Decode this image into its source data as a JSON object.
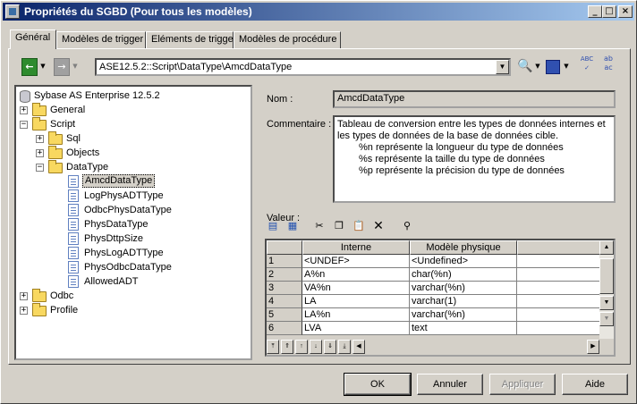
{
  "window": {
    "title": "Propriétés du SGBD (Pour tous les modèles)"
  },
  "tabs": [
    {
      "label": "Général"
    },
    {
      "label": "Modèles de trigger"
    },
    {
      "label": "Eléments de trigger"
    },
    {
      "label": "Modèles de procédure"
    }
  ],
  "toolbar": {
    "path": "ASE12.5.2::Script\\DataType\\AmcdDataType",
    "spell1": "ABC",
    "spell2": "ab"
  },
  "tree": [
    {
      "label": "Sybase AS Enterprise 12.5.2"
    },
    {
      "label": "General"
    },
    {
      "label": "Script"
    },
    {
      "label": "Sql"
    },
    {
      "label": "Objects"
    },
    {
      "label": "DataType"
    },
    {
      "label": "AmcdDataType"
    },
    {
      "label": "LogPhysADTType"
    },
    {
      "label": "OdbcPhysDataType"
    },
    {
      "label": "PhysDataType"
    },
    {
      "label": "PhysDttpSize"
    },
    {
      "label": "PhysLogADTType"
    },
    {
      "label": "PhysOdbcDataType"
    },
    {
      "label": "AllowedADT"
    },
    {
      "label": "Odbc"
    },
    {
      "label": "Profile"
    }
  ],
  "details": {
    "name_label": "Nom :",
    "name_value": "AmcdDataType",
    "comment_label": "Commentaire :",
    "comment_lines": [
      "Tableau de conversion entre les types de données internes et les types de données de la base de données cible.",
      "%n représente la longueur du type de données",
      "%s représente la taille du type de données",
      "%p représente la précision du type de données"
    ],
    "value_label": "Valeur :"
  },
  "grid": {
    "headers": [
      "Interne",
      "Modèle physique"
    ],
    "rows": [
      {
        "n": "1",
        "a": "<UNDEF>",
        "b": "<Undefined>"
      },
      {
        "n": "2",
        "a": "A%n",
        "b": "char(%n)"
      },
      {
        "n": "3",
        "a": "VA%n",
        "b": "varchar(%n)"
      },
      {
        "n": "4",
        "a": "LA",
        "b": "varchar(1)"
      },
      {
        "n": "5",
        "a": "LA%n",
        "b": "varchar(%n)"
      },
      {
        "n": "6",
        "a": "LVA",
        "b": "text"
      }
    ]
  },
  "buttons": {
    "ok": "OK",
    "cancel": "Annuler",
    "apply": "Appliquer",
    "help": "Aide"
  }
}
